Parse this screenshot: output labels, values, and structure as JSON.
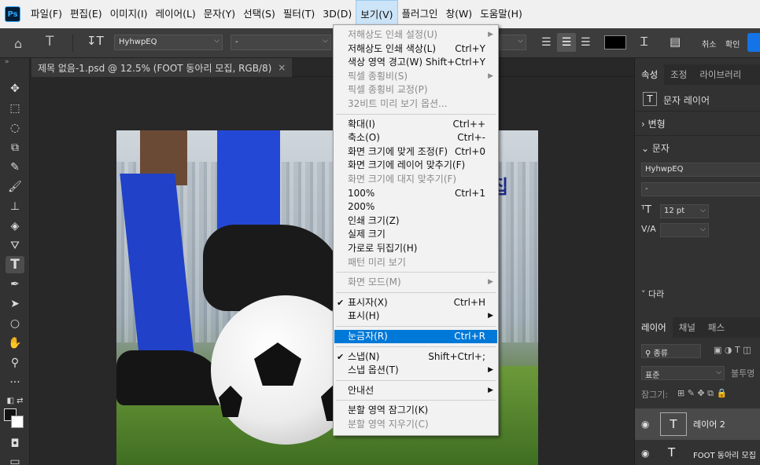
{
  "app": {
    "logo": "Ps"
  },
  "menubar": [
    "파일(F)",
    "편집(E)",
    "이미지(I)",
    "레이어(L)",
    "문자(Y)",
    "선택(S)",
    "필터(T)",
    "3D(D)",
    "보기(V)",
    "플러그인",
    "창(W)",
    "도움말(H)"
  ],
  "options_bar": {
    "font_family": "HyhwpEQ",
    "font_style": "-",
    "color_swatch": "#000000",
    "labels": [
      "취소",
      "확인"
    ]
  },
  "document": {
    "tab_title": "제목 없음-1.psd @ 12.5% (FOOT 동아리 모집, RGB/8)",
    "close": "×"
  },
  "view_menu": {
    "items": [
      {
        "label": "저해상도 인쇄 설정(U)",
        "disabled": true,
        "submenu": true
      },
      {
        "label": "저해상도 인쇄 색상(L)",
        "shortcut": "Ctrl+Y"
      },
      {
        "label": "색상 영역 경고(W)",
        "shortcut": "Shift+Ctrl+Y"
      },
      {
        "label": "픽셀 종횡비(S)",
        "disabled": true,
        "submenu": true
      },
      {
        "label": "픽셀 종횡비 교정(P)",
        "disabled": true
      },
      {
        "label": "32비트 미리 보기 옵션...",
        "disabled": true
      },
      {
        "sep": true
      },
      {
        "label": "확대(I)",
        "shortcut": "Ctrl++"
      },
      {
        "label": "축소(O)",
        "shortcut": "Ctrl+-"
      },
      {
        "label": "화면 크기에 맞게 조정(F)",
        "shortcut": "Ctrl+0"
      },
      {
        "label": "화면 크기에 레이어 맞추기(F)"
      },
      {
        "label": "화면 크기에 대지 맞추기(F)",
        "disabled": true
      },
      {
        "label": "100%",
        "shortcut": "Ctrl+1"
      },
      {
        "label": "200%"
      },
      {
        "label": "인쇄 크기(Z)"
      },
      {
        "label": "실제 크기"
      },
      {
        "label": "가로로 뒤집기(H)"
      },
      {
        "label": "패턴 미리 보기",
        "disabled": true
      },
      {
        "sep": true
      },
      {
        "label": "화면 모드(M)",
        "disabled": true,
        "submenu": true
      },
      {
        "sep": true
      },
      {
        "label": "표시자(X)",
        "shortcut": "Ctrl+H",
        "checked": true
      },
      {
        "label": "표시(H)",
        "submenu": true
      },
      {
        "sep": true
      },
      {
        "label": "눈금자(R)",
        "shortcut": "Ctrl+R",
        "highlighted": true
      },
      {
        "sep": true
      },
      {
        "label": "스냅(N)",
        "shortcut": "Shift+Ctrl+;",
        "checked": true
      },
      {
        "label": "스냅 옵션(T)",
        "submenu": true
      },
      {
        "sep": true
      },
      {
        "label": "안내선",
        "submenu": true
      },
      {
        "sep": true
      },
      {
        "label": "분할 영역 잠그기(K)"
      },
      {
        "label": "분할 영역 지우기(C)",
        "disabled": true
      }
    ]
  },
  "canvas_overlay_text": "집",
  "right_panel": {
    "tabs_top": [
      "속성",
      "조정",
      "라이브러리"
    ],
    "text_layer_label": "문자 레이어",
    "transform": "변형",
    "character": "문자",
    "font_family": "HyhwpEQ",
    "font_style": "-",
    "font_size": "12 pt",
    "kerning_label": "V/A",
    "paragraph_partial": "다라",
    "layers_tabs": [
      "레이어",
      "채널",
      "패스"
    ],
    "search_placeholder": "종류",
    "blend_mode": "표준",
    "opacity_label": "불투명",
    "lock_label": "잠그기:",
    "layers": [
      "레이어 2",
      "FOOT 동아리 모집"
    ]
  },
  "colors": {
    "menu_highlight": "#0078d7",
    "panel_bg": "#323232"
  }
}
